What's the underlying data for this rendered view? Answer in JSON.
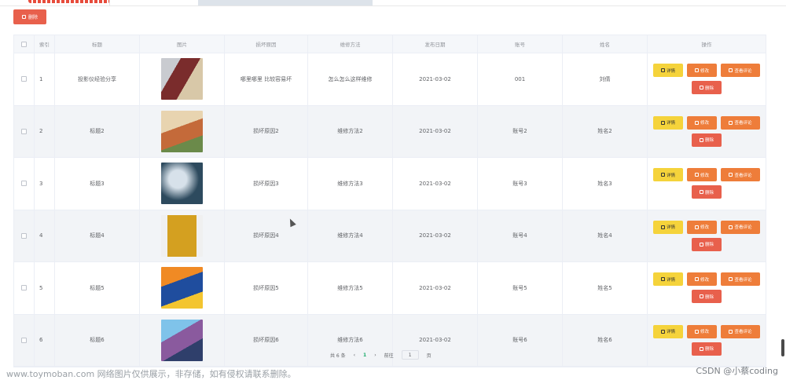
{
  "toolbar": {
    "delete_label": "删除"
  },
  "table": {
    "headers": {
      "index": "索引",
      "title": "标题",
      "image": "图片",
      "reason": "损坏原因",
      "method": "维修方法",
      "date": "发布日期",
      "account": "账号",
      "name": "姓名",
      "ops": "操作"
    },
    "rows": [
      {
        "index": "1",
        "title": "投影仪经验分享",
        "reason": "哪里哪里 比较容易坏",
        "method": "怎么怎么这样维修",
        "date": "2021-03-02",
        "account": "001",
        "name": "刘倩"
      },
      {
        "index": "2",
        "title": "标题2",
        "reason": "损坏原因2",
        "method": "维修方法2",
        "date": "2021-03-02",
        "account": "账号2",
        "name": "姓名2"
      },
      {
        "index": "3",
        "title": "标题3",
        "reason": "损坏原因3",
        "method": "维修方法3",
        "date": "2021-03-02",
        "account": "账号3",
        "name": "姓名3"
      },
      {
        "index": "4",
        "title": "标题4",
        "reason": "损坏原因4",
        "method": "维修方法4",
        "date": "2021-03-02",
        "account": "账号4",
        "name": "姓名4"
      },
      {
        "index": "5",
        "title": "标题5",
        "reason": "损坏原因5",
        "method": "维修方法5",
        "date": "2021-03-02",
        "account": "账号5",
        "name": "姓名5"
      },
      {
        "index": "6",
        "title": "标题6",
        "reason": "损坏原因6",
        "method": "维修方法6",
        "date": "2021-03-02",
        "account": "账号6",
        "name": "姓名6"
      }
    ],
    "buttons": {
      "detail": "详情",
      "edit": "修改",
      "review": "查看评论",
      "delete": "删除"
    }
  },
  "pager": {
    "total": "共 6 条",
    "prev": "‹",
    "page": "1",
    "next": "›",
    "goto": "前往",
    "goto_value": "1",
    "page_unit": "页"
  },
  "watermark": {
    "left": "www.toymoban.com 网络图片仅供展示，非存储，如有侵权请联系删除。",
    "right": "CSDN @小蔡coding"
  },
  "colors": {
    "detail": "#f5d33b",
    "edit": "#ee7d3a",
    "delete": "#e8604c",
    "accent": "#1aab6a"
  }
}
